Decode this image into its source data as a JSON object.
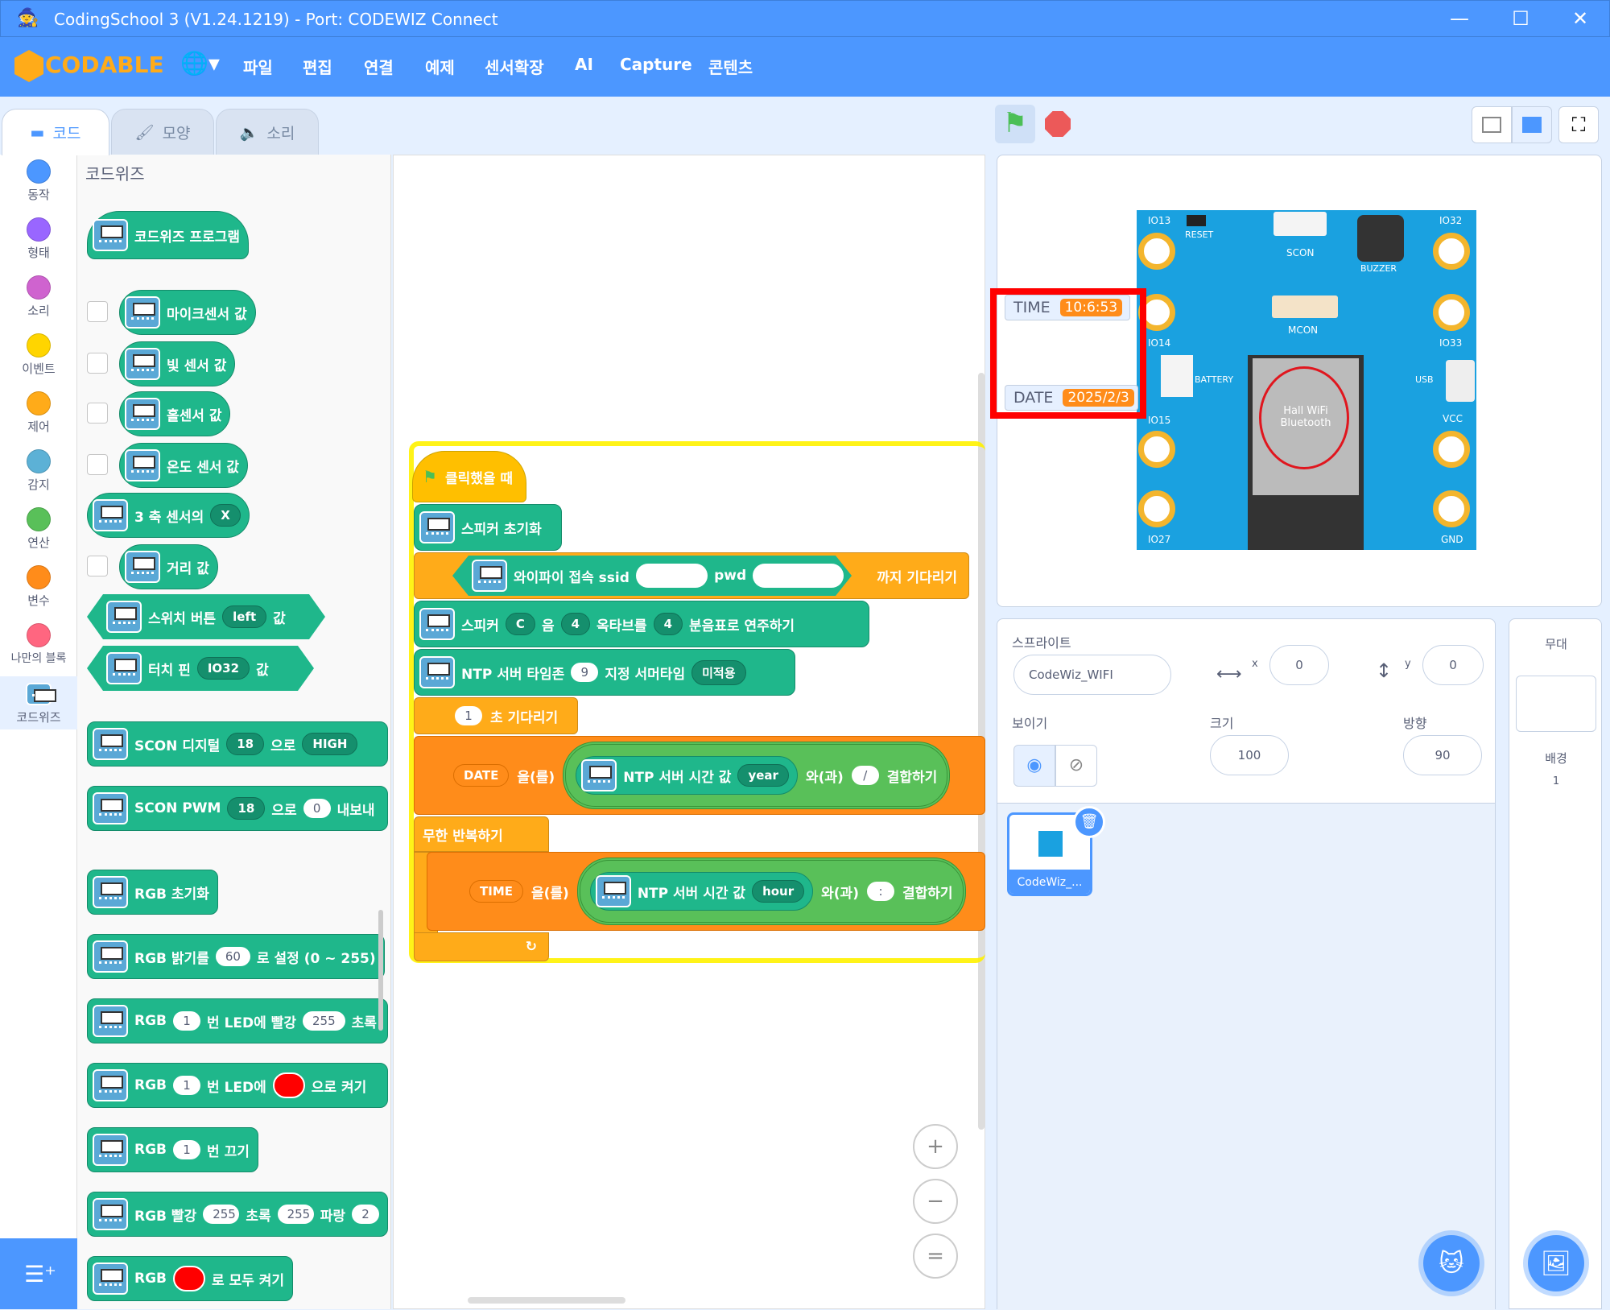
{
  "window": {
    "title": "CodingSchool 3 (V1.24.1219) - Port: CODEWIZ Connect",
    "minimize": "—",
    "maximize": "☐",
    "close": "✕"
  },
  "menu": {
    "logo": "CODABLE",
    "items": [
      "파일",
      "편집",
      "연결",
      "예제",
      "센서확장",
      "AI",
      "Capture",
      "콘텐츠"
    ]
  },
  "tabs": [
    "코드",
    "모양",
    "소리"
  ],
  "categories": [
    {
      "label": "동작",
      "color": "#4c97ff"
    },
    {
      "label": "형태",
      "color": "#9966ff"
    },
    {
      "label": "소리",
      "color": "#cf63cf"
    },
    {
      "label": "이벤트",
      "color": "#ffd500"
    },
    {
      "label": "제어",
      "color": "#ffab19"
    },
    {
      "label": "감지",
      "color": "#5cb1d6"
    },
    {
      "label": "연산",
      "color": "#59c059"
    },
    {
      "label": "변수",
      "color": "#ff8c1a"
    },
    {
      "label": "나만의 블록",
      "color": "#ff6680"
    },
    {
      "label": "코드위즈",
      "color": "#1fb78b"
    }
  ],
  "palette": {
    "heading": "코드위즈",
    "program": "코드위즈 프로그램",
    "mic": "마이크센서 값",
    "light": "빛 센서 값",
    "hall": "홀센서 값",
    "temp": "온도 센서 값",
    "axis": {
      "pre": "3 축 센서의",
      "opt": "X"
    },
    "distance": "거리 값",
    "switch": {
      "pre": "스위치 버튼",
      "opt": "left",
      "post": "값"
    },
    "touch": {
      "pre": "터치 핀",
      "opt": "IO32",
      "post": "값"
    },
    "scon_digital": {
      "pre": "SCON 디지털",
      "pin": "18",
      "mid": "으로",
      "val": "HIGH"
    },
    "scon_pwm": {
      "pre": "SCON PWM",
      "pin": "18",
      "mid": "으로",
      "val": "0",
      "post": "내보내"
    },
    "rgb_init": "RGB 초기화",
    "rgb_bright": {
      "pre": "RGB 밝기를",
      "val": "60",
      "post": "로 설정 (0 ~ 255)"
    },
    "rgb_led": {
      "pre": "RGB",
      "n": "1",
      "mid": "번 LED에 빨강",
      "r": "255",
      "post": "초록"
    },
    "rgb_color": {
      "pre": "RGB",
      "n": "1",
      "mid": "번 LED에",
      "post": "으로 켜기"
    },
    "rgb_off": {
      "pre": "RGB",
      "n": "1",
      "post": "번 끄기"
    },
    "rgb_all": {
      "pre": "RGB 빨강",
      "r": "255",
      "g_label": "초록",
      "g": "255",
      "b_label": "파랑",
      "b": "2"
    },
    "rgb_all_color": {
      "pre": "RGB",
      "post": "로 모두 켜기"
    }
  },
  "script": {
    "hat": "클릭했을 때",
    "speaker_init": "스피커 초기화",
    "wifi": {
      "pre": "와이파이 접속 ssid",
      "pwd": "pwd",
      "post": "까지 기다리기"
    },
    "speaker_play": {
      "pre": "스피커",
      "note": "C",
      "mid1": "음",
      "oct": "4",
      "mid2": "옥타브를",
      "beat": "4",
      "post": "분음표로 연주하기"
    },
    "ntp": {
      "pre": "NTP 서버 타임존",
      "tz": "9",
      "mid": "지정 서머타임",
      "opt": "미적용"
    },
    "wait": {
      "n": "1",
      "post": "초 기다리기"
    },
    "set_date": {
      "var": "DATE",
      "mid": "을(를)",
      "inner": "NTP 서버 시간 값",
      "unit": "year",
      "join": "와(과)",
      "sep": "/",
      "post": "결합하기"
    },
    "forever": "무한 반복하기",
    "set_time": {
      "var": "TIME",
      "mid": "을(를)",
      "inner": "NTP 서버 시간 값",
      "unit": "hour",
      "join": "와(과)",
      "sep": ":",
      "post": "결합하기"
    }
  },
  "zoom": {
    "in": "+",
    "out": "−",
    "reset": "="
  },
  "stage": {
    "time_label": "TIME",
    "time_value": "10:6:53",
    "date_label": "DATE",
    "date_value": "2025/2/3",
    "board": {
      "io13": "IO13",
      "reset": "RESET",
      "scon": "SCON",
      "buzzer": "BUZZER",
      "io32": "IO32",
      "io14": "IO14",
      "mcon": "MCON",
      "io33": "IO33",
      "battery": "BATTERY",
      "usb": "USB",
      "vcc": "VCC",
      "io15": "IO15",
      "io27": "IO27",
      "gnd": "GND",
      "chip": "Hall WiFi Bluetooth"
    }
  },
  "sprite_pane": {
    "label": "스프라이트",
    "name": "CodeWiz_WIFI",
    "x_label": "x",
    "x": "0",
    "y_label": "y",
    "y": "0",
    "show_label": "보이기",
    "size_label": "크기",
    "size": "100",
    "dir_label": "방향",
    "dir": "90",
    "sprite_thumb": "CodeWiz_..."
  },
  "stage_pane": {
    "label": "무대",
    "bg_label": "배경",
    "bg_count": "1"
  }
}
